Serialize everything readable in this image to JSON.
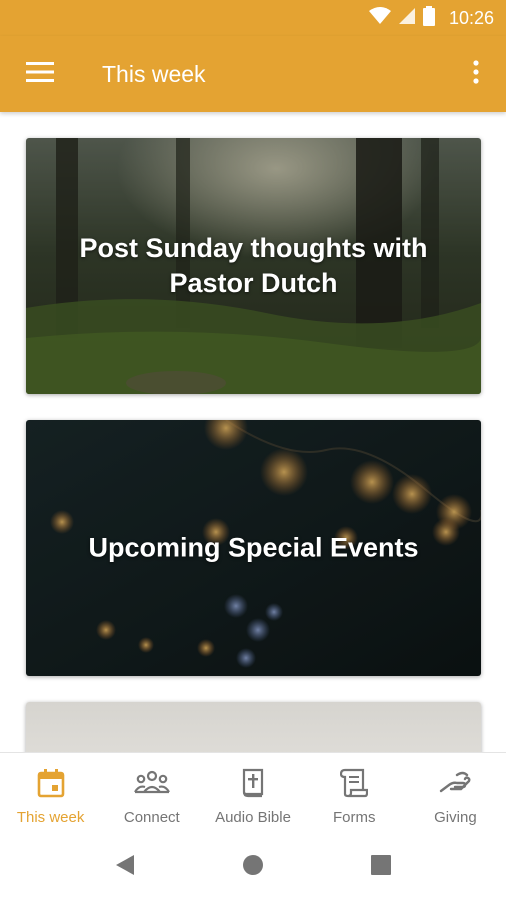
{
  "status_bar": {
    "time": "10:26"
  },
  "app_bar": {
    "title": "This week"
  },
  "cards": [
    {
      "title": "Post Sunday thoughts with Pastor Dutch"
    },
    {
      "title": "Upcoming Special Events"
    },
    {
      "title": ""
    }
  ],
  "bottom_nav": {
    "items": [
      {
        "label": "This week",
        "icon": "calendar-icon",
        "active": true
      },
      {
        "label": "Connect",
        "icon": "people-icon",
        "active": false
      },
      {
        "label": "Audio Bible",
        "icon": "bible-icon",
        "active": false
      },
      {
        "label": "Forms",
        "icon": "scroll-icon",
        "active": false
      },
      {
        "label": "Giving",
        "icon": "giving-hand-icon",
        "active": false
      }
    ]
  },
  "colors": {
    "primary": "#e4a332",
    "inactive": "#757575"
  }
}
